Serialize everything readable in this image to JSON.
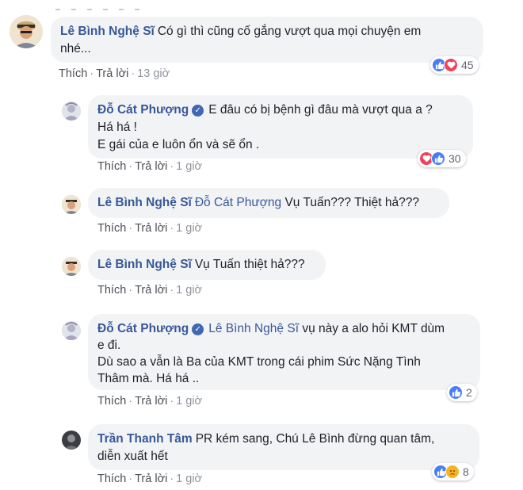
{
  "comments": [
    {
      "author": "Lê Bình Nghệ Sĩ",
      "verified": false,
      "mention": "",
      "text": "Có gì thì cũng cố gắng vượt qua mọi chuyện em",
      "text2": "nhé...",
      "actions": {
        "like": "Thích",
        "reply": "Trả lời",
        "time": "13 giờ"
      },
      "reactions": {
        "icons": [
          "like-icon",
          "love-icon"
        ],
        "count": "45"
      }
    },
    {
      "author": "Đỗ Cát Phượng",
      "verified": true,
      "mention": "",
      "text": "E đâu có bị bệnh gì đâu mà vượt qua a ?",
      "text2": "Há há !",
      "text3": "E gái của e luôn ổn và sẽ ổn .",
      "actions": {
        "like": "Thích",
        "reply": "Trả lời",
        "time": "1 giờ"
      },
      "reactions": {
        "icons": [
          "love-icon",
          "like-icon"
        ],
        "count": "30"
      }
    },
    {
      "author": "Lê Bình Nghệ Sĩ",
      "verified": false,
      "mention": "Đỗ Cát Phượng",
      "text": "Vụ Tuấn??? Thiệt hả???",
      "actions": {
        "like": "Thích",
        "reply": "Trả lời",
        "time": "1 giờ"
      }
    },
    {
      "author": "Lê Bình Nghệ Sĩ",
      "verified": false,
      "mention": "",
      "text": "Vụ Tuấn thiệt hả???",
      "actions": {
        "like": "Thích",
        "reply": "Trả lời",
        "time": "1 giờ"
      }
    },
    {
      "author": "Đỗ Cát Phượng",
      "verified": true,
      "mention": "Lê Bình Nghệ Sĩ",
      "text": "vụ này a alo hỏi KMT dùm",
      "text2": "e đi.",
      "text3": "Dù sao a vẫn là Ba của KMT trong cái phim Sức Nặng Tình",
      "text4": "Thâm mà. Há há ..",
      "actions": {
        "like": "Thích",
        "reply": "Trả lời",
        "time": "1 giờ"
      },
      "reactions": {
        "icons": [
          "like-icon"
        ],
        "count": "2"
      }
    },
    {
      "author": "Trần Thanh Tâm",
      "verified": false,
      "mention": "",
      "text": "PR kém sang, Chú Lê Bình đừng quan tâm,",
      "text2": "diễn xuất hết",
      "actions": {
        "like": "Thích",
        "reply": "Trả lời",
        "time": "1 giờ"
      },
      "reactions": {
        "icons": [
          "like-icon",
          "sad-icon"
        ],
        "count": "8"
      }
    }
  ],
  "colors": {
    "author": "#385898",
    "bubble": "#f2f3f5",
    "like": "#4a7ff3",
    "love": "#f0415a",
    "sad": "#f7b125"
  }
}
